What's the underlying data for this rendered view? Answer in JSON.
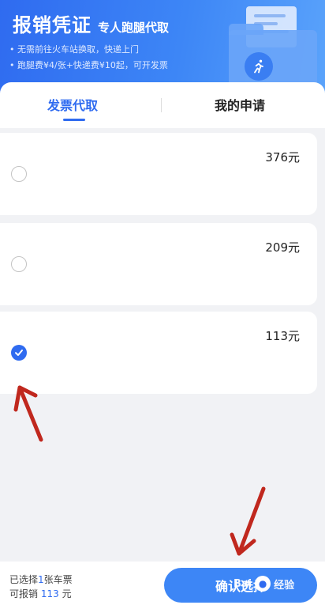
{
  "header": {
    "title": "报销凭证",
    "subtitle": "专人跑腿代取",
    "bullets": [
      "• 无需前往火车站换取，快递上门",
      "• 跑腿费¥4/张+快递费¥10起，可开发票"
    ],
    "brand_color": "#2f6bf0"
  },
  "tabs": [
    {
      "label": "发票代取",
      "active": true
    },
    {
      "label": "我的申请",
      "active": false
    }
  ],
  "tickets": [
    {
      "amount": "376元",
      "selected": false
    },
    {
      "amount": "209元",
      "selected": false
    },
    {
      "amount": "113元",
      "selected": true
    }
  ],
  "footer": {
    "selected_prefix": "已选择",
    "selected_count": "1",
    "selected_suffix": "张车票",
    "reimbursable_prefix": "可报销",
    "reimbursable_amount": "113",
    "reimbursable_suffix": "元",
    "confirm_label": "确认选择"
  },
  "watermark": {
    "text": "Bai",
    "text2": "经验"
  },
  "icons": {
    "runner": "runner-icon",
    "check": "check-icon",
    "paw": "baidu-paw-icon"
  },
  "annotation_color": "#c0281e"
}
